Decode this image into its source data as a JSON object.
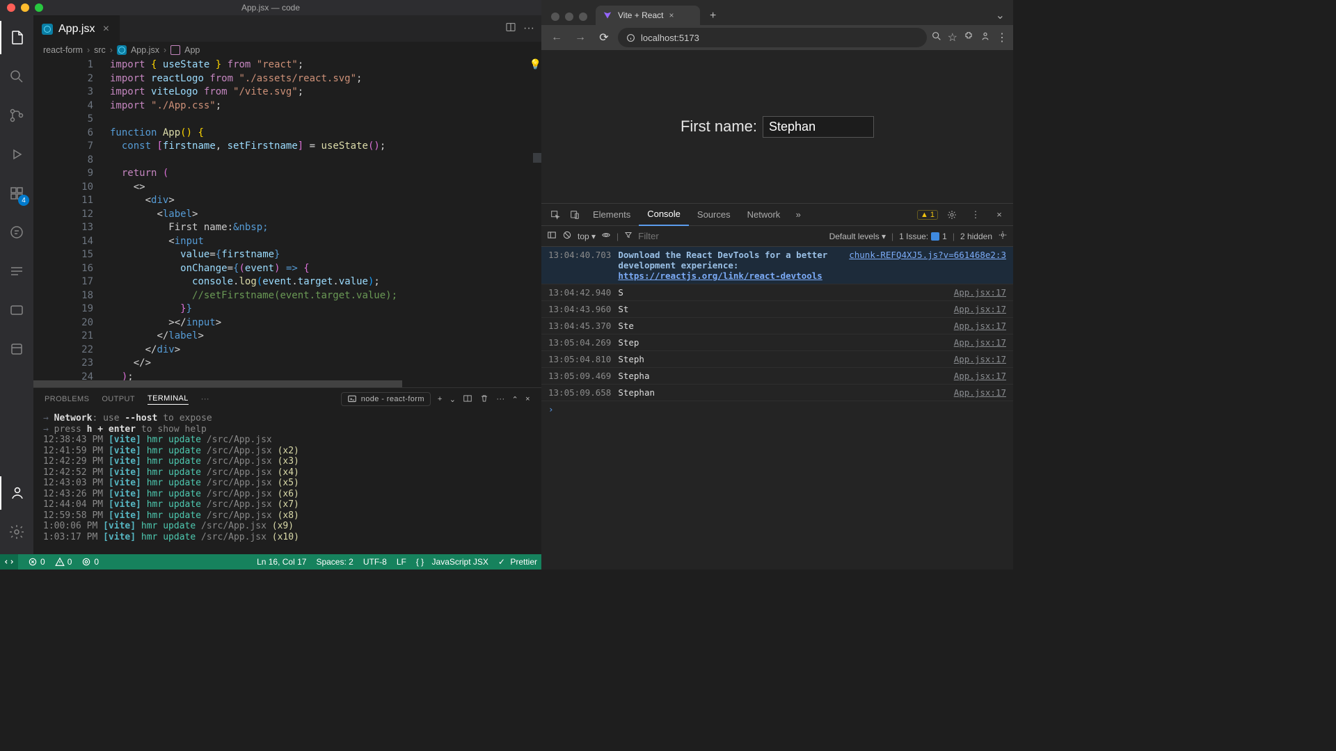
{
  "vscode": {
    "title": "App.jsx — code",
    "tab": {
      "filename": "App.jsx"
    },
    "tab_actions": {
      "split_icon": "split",
      "more_icon": "more"
    },
    "activity_badge": "4",
    "breadcrumbs": {
      "items": [
        "react-form",
        "src",
        "App.jsx",
        "App"
      ]
    },
    "code_lines": [
      {
        "n": 1,
        "html": "<span class='k'>import</span> <span class='br'>{</span> <span class='v'>useState</span> <span class='br'>}</span> <span class='k'>from</span> <span class='s'>\"react\"</span><span class='p'>;</span>"
      },
      {
        "n": 2,
        "html": "<span class='k'>import</span> <span class='v'>reactLogo</span> <span class='k'>from</span> <span class='s'>\"./assets/react.svg\"</span><span class='p'>;</span>"
      },
      {
        "n": 3,
        "html": "<span class='k'>import</span> <span class='v'>viteLogo</span> <span class='k'>from</span> <span class='s'>\"/vite.svg\"</span><span class='p'>;</span>"
      },
      {
        "n": 4,
        "html": "<span class='k'>import</span> <span class='s'>\"./App.css\"</span><span class='p'>;</span>"
      },
      {
        "n": 5,
        "html": ""
      },
      {
        "n": 6,
        "html": "<span class='b'>function</span> <span class='f'>App</span><span class='br'>()</span> <span class='br'>{</span>"
      },
      {
        "n": 7,
        "html": "  <span class='b'>const</span> <span class='br2'>[</span><span class='v'>firstname</span><span class='p'>,</span> <span class='v'>setFirstname</span><span class='br2'>]</span> <span class='p'>=</span> <span class='f'>useState</span><span class='br2'>()</span><span class='p'>;</span>"
      },
      {
        "n": 8,
        "html": ""
      },
      {
        "n": 9,
        "html": "  <span class='k'>return</span> <span class='br2'>(</span>"
      },
      {
        "n": 10,
        "html": "    <span class='p'>&lt;&gt;</span>"
      },
      {
        "n": 11,
        "html": "      <span class='p'>&lt;</span><span class='b'>div</span><span class='p'>&gt;</span>"
      },
      {
        "n": 12,
        "html": "        <span class='p'>&lt;</span><span class='b'>label</span><span class='p'>&gt;</span>"
      },
      {
        "n": 13,
        "html": "          First name:<span class='b'>&amp;nbsp;</span>"
      },
      {
        "n": 14,
        "html": "          <span class='p'>&lt;</span><span class='b'>input</span>"
      },
      {
        "n": 15,
        "html": "            <span class='v'>value</span><span class='p'>=</span><span class='b'>{</span><span class='v'>firstname</span><span class='b'>}</span>"
      },
      {
        "n": 16,
        "html": "            <span class='v'>onChange</span><span class='p'>=</span><span class='b'>{</span><span class='br2'>(</span><span class='v'>event</span><span class='br2'>)</span> <span class='b'>=&gt;</span> <span class='br2'>{</span>",
        "cursor": true
      },
      {
        "n": 17,
        "html": "              <span class='v'>console</span><span class='p'>.</span><span class='f'>log</span><span class='br3'>(</span><span class='v'>event</span><span class='p'>.</span><span class='v'>target</span><span class='p'>.</span><span class='v'>value</span><span class='br3'>)</span><span class='p'>;</span>"
      },
      {
        "n": 18,
        "html": "              <span class='c'>//setFirstname(event.target.value);</span>"
      },
      {
        "n": 19,
        "html": "            <span class='br2'>}</span><span class='b'>}</span>"
      },
      {
        "n": 20,
        "html": "          <span class='p'>&gt;&lt;/</span><span class='b'>input</span><span class='p'>&gt;</span>"
      },
      {
        "n": 21,
        "html": "        <span class='p'>&lt;/</span><span class='b'>label</span><span class='p'>&gt;</span>"
      },
      {
        "n": 22,
        "html": "      <span class='p'>&lt;/</span><span class='b'>div</span><span class='p'>&gt;</span>"
      },
      {
        "n": 23,
        "html": "    <span class='p'>&lt;/&gt;</span>"
      },
      {
        "n": 24,
        "html": "  <span class='br2'>)</span><span class='p'>;</span>"
      }
    ],
    "panel_tabs": {
      "problems": "PROBLEMS",
      "output": "OUTPUT",
      "terminal": "TERMINAL",
      "more": "···"
    },
    "task_label": "node - react-form",
    "terminal_lines": [
      {
        "html": "  <span class='term-arrow'>→</span>  <span class='term-bold'>Network</span><span class='term-dim'>: use </span><span class='term-bold'>--host</span><span class='term-dim'> to expose</span>"
      },
      {
        "html": "  <span class='term-arrow'>→</span>  <span class='term-dim'>press </span><span class='term-bold'>h + enter</span><span class='term-dim'> to show help</span>"
      },
      {
        "html": "<span class='term-dim'>12:38:43 PM</span> <span class='term-cyan'>[vite]</span> <span class='t'>hmr update</span> <span class='term-dim'>/src/App.jsx</span>"
      },
      {
        "html": "<span class='term-dim'>12:41:59 PM</span> <span class='term-cyan'>[vite]</span> <span class='t'>hmr update</span> <span class='term-dim'>/src/App.jsx</span> <span class='f'>(x2)</span>"
      },
      {
        "html": "<span class='term-dim'>12:42:29 PM</span> <span class='term-cyan'>[vite]</span> <span class='t'>hmr update</span> <span class='term-dim'>/src/App.jsx</span> <span class='f'>(x3)</span>"
      },
      {
        "html": "<span class='term-dim'>12:42:52 PM</span> <span class='term-cyan'>[vite]</span> <span class='t'>hmr update</span> <span class='term-dim'>/src/App.jsx</span> <span class='f'>(x4)</span>"
      },
      {
        "html": "<span class='term-dim'>12:43:03 PM</span> <span class='term-cyan'>[vite]</span> <span class='t'>hmr update</span> <span class='term-dim'>/src/App.jsx</span> <span class='f'>(x5)</span>"
      },
      {
        "html": "<span class='term-dim'>12:43:26 PM</span> <span class='term-cyan'>[vite]</span> <span class='t'>hmr update</span> <span class='term-dim'>/src/App.jsx</span> <span class='f'>(x6)</span>"
      },
      {
        "html": "<span class='term-dim'>12:44:04 PM</span> <span class='term-cyan'>[vite]</span> <span class='t'>hmr update</span> <span class='term-dim'>/src/App.jsx</span> <span class='f'>(x7)</span>"
      },
      {
        "html": "<span class='term-dim'>12:59:58 PM</span> <span class='term-cyan'>[vite]</span> <span class='t'>hmr update</span> <span class='term-dim'>/src/App.jsx</span> <span class='f'>(x8)</span>"
      },
      {
        "html": "<span class='term-dim'>1:00:06 PM</span> <span class='term-cyan'>[vite]</span> <span class='t'>hmr update</span> <span class='term-dim'>/src/App.jsx</span> <span class='f'>(x9)</span>"
      },
      {
        "html": "<span class='term-dim'>1:03:17 PM</span> <span class='term-cyan'>[vite]</span> <span class='t'>hmr update</span> <span class='term-dim'>/src/App.jsx</span> <span class='f'>(x10)</span>"
      }
    ],
    "statusbar": {
      "errors": "0",
      "warnings": "0",
      "ports": "0",
      "cursor": "Ln 16, Col 17",
      "spaces": "Spaces: 2",
      "encoding": "UTF-8",
      "eol": "LF",
      "lang": "JavaScript JSX",
      "prettier": "Prettier"
    }
  },
  "browser": {
    "tab_title": "Vite + React",
    "url": "localhost:5173",
    "page": {
      "label": "First name:",
      "value": "Stephan"
    },
    "devtools": {
      "tabs": [
        "Elements",
        "Console",
        "Sources",
        "Network"
      ],
      "active": "Console",
      "issue_count": "1",
      "toolbar": {
        "context": "top",
        "filter_placeholder": "Filter",
        "levels": "Default levels",
        "issues": "1 Issue:",
        "issues_n": "1",
        "hidden": "2 hidden"
      },
      "logs": [
        {
          "ts": "13:04:40.703",
          "type": "info",
          "msg": "Download the React DevTools for a better development experience:",
          "link": "https://reactjs.org/link/react-devtools",
          "src": "chunk-REFQ4XJ5.js?v=661468e2:3"
        },
        {
          "ts": "13:04:42.940",
          "msg": "S",
          "src": "App.jsx:17"
        },
        {
          "ts": "13:04:43.960",
          "msg": "St",
          "src": "App.jsx:17"
        },
        {
          "ts": "13:04:45.370",
          "msg": "Ste",
          "src": "App.jsx:17"
        },
        {
          "ts": "13:05:04.269",
          "msg": "Step",
          "src": "App.jsx:17"
        },
        {
          "ts": "13:05:04.810",
          "msg": "Steph",
          "src": "App.jsx:17"
        },
        {
          "ts": "13:05:09.469",
          "msg": "Stepha",
          "src": "App.jsx:17"
        },
        {
          "ts": "13:05:09.658",
          "msg": "Stephan",
          "src": "App.jsx:17"
        }
      ]
    }
  }
}
